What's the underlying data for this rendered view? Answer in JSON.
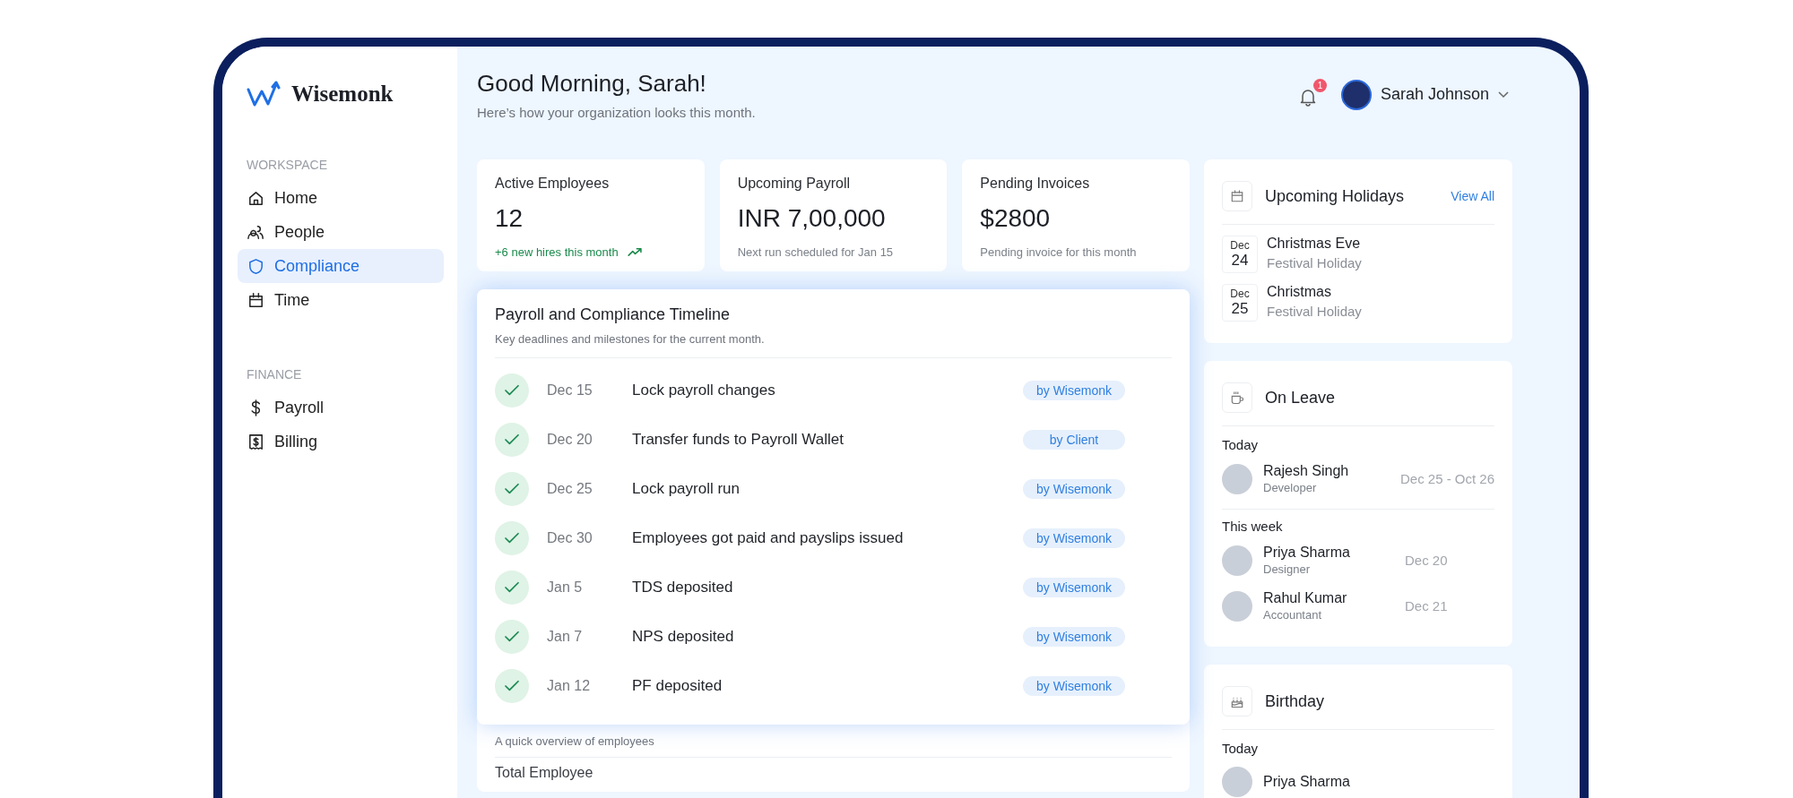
{
  "brand": {
    "name": "Wisemonk"
  },
  "sidebar": {
    "sections": [
      {
        "heading": "WORKSPACE",
        "items": [
          {
            "label": "Home",
            "kind": "home",
            "selected": false
          },
          {
            "label": "People",
            "kind": "people",
            "selected": false
          },
          {
            "label": "Compliance",
            "kind": "shield",
            "selected": true
          },
          {
            "label": "Time",
            "kind": "calendar",
            "selected": false
          }
        ]
      },
      {
        "heading": "FINANCE",
        "items": [
          {
            "label": "Payroll",
            "kind": "dollar",
            "selected": false
          },
          {
            "label": "Billing",
            "kind": "bill",
            "selected": false
          }
        ]
      }
    ]
  },
  "header": {
    "greeting": "Good Morning, Sarah!",
    "subtitle": "Here’s how your organization looks this month.",
    "notifications": "1",
    "user": {
      "name": "Sarah Johnson"
    }
  },
  "stats": [
    {
      "label": "Active Employees",
      "value": "12",
      "note": "+6 new hires this month",
      "kind": "growth"
    },
    {
      "label": "Upcoming Payroll",
      "value": "INR 7,00,000",
      "note": "Next run scheduled for Jan 15",
      "kind": "plain"
    },
    {
      "label": "Pending Invoices",
      "value": "$2800",
      "note": "Pending invoice for this month",
      "kind": "plain"
    }
  ],
  "timeline": {
    "title": "Payroll and Compliance Timeline",
    "subtitle": "Key deadlines and milestones for the current month.",
    "items": [
      {
        "date": "Dec 15",
        "task": "Lock payroll changes",
        "owner": "by Wisemonk",
        "completed": true
      },
      {
        "date": "Dec 20",
        "task": "Transfer funds to Payroll Wallet",
        "owner": "by Client",
        "completed": true
      },
      {
        "date": "Dec 25",
        "task": "Lock payroll run",
        "owner": "by Wisemonk",
        "completed": true
      },
      {
        "date": "Dec 30",
        "task": "Employees got paid and payslips issued",
        "owner": "by Wisemonk",
        "completed": true
      },
      {
        "date": "Jan 5",
        "task": "TDS deposited",
        "owner": "by Wisemonk",
        "completed": true
      },
      {
        "date": "Jan 7",
        "task": "NPS deposited",
        "owner": "by Wisemonk",
        "completed": true
      },
      {
        "date": "Jan 12",
        "task": "PF deposited",
        "owner": "by Wisemonk",
        "completed": true
      }
    ]
  },
  "overview": {
    "subtitle": "A quick overview of employees",
    "rows": [
      "Total Employee"
    ]
  },
  "holidays": {
    "title": "Upcoming Holidays",
    "action": "View All",
    "items": [
      {
        "month": "Dec",
        "day": "24",
        "name": "Christmas Eve",
        "type": "Festival Holiday"
      },
      {
        "month": "Dec",
        "day": "25",
        "name": "Christmas",
        "type": "Festival Holiday"
      }
    ]
  },
  "on_leave": {
    "title": "On Leave",
    "groups": [
      {
        "heading": "Today",
        "people": [
          {
            "name": "Rajesh Singh",
            "role": "Developer",
            "dates": "Dec 25 - Oct 26"
          }
        ]
      },
      {
        "heading": "This week",
        "people": [
          {
            "name": "Priya Sharma",
            "role": "Designer",
            "dates": "Dec 20"
          },
          {
            "name": "Rahul Kumar",
            "role": "Accountant",
            "dates": "Dec 21"
          }
        ]
      }
    ]
  },
  "birthday": {
    "title": "Birthday",
    "groups": [
      {
        "heading": "Today",
        "people": [
          {
            "name": "Priya Sharma"
          }
        ]
      }
    ]
  }
}
